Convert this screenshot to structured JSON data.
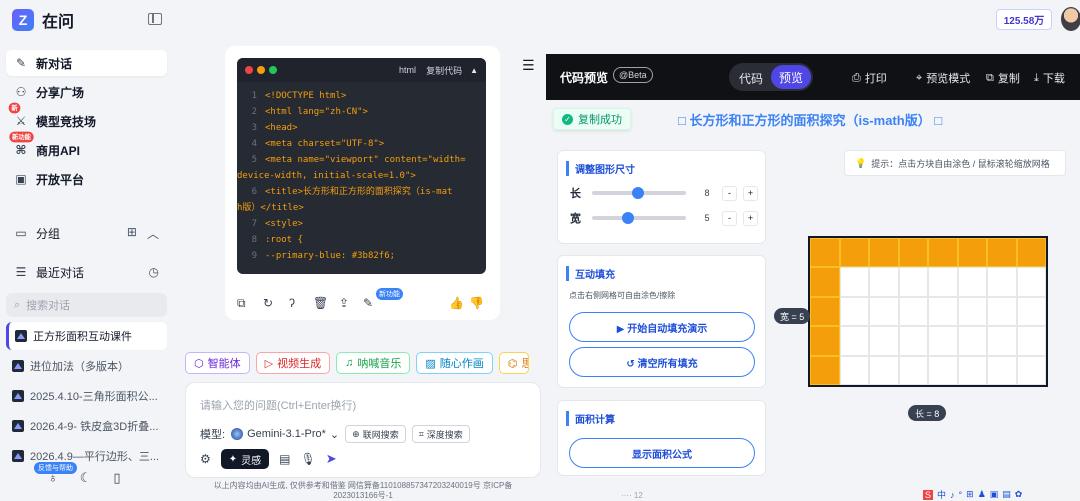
{
  "app": {
    "brand_logo": "Z",
    "name": "在问"
  },
  "sidebar": {
    "nav": [
      {
        "label": "新对话",
        "icon": "chat-plus-icon"
      },
      {
        "label": "分享广场",
        "icon": "grid-icon"
      },
      {
        "label": "模型竞技场",
        "icon": "arena-icon",
        "badge": "新"
      },
      {
        "label": "商用API",
        "icon": "api-icon",
        "badge": "新功能"
      },
      {
        "label": "开放平台",
        "icon": "platform-icon"
      }
    ],
    "group_label": "分组",
    "recent_label": "最近对话",
    "search_placeholder": "搜索对话",
    "conversations": [
      "正方形面积互动课件",
      "进位加法（多版本）",
      "2025.4.10-三角形面积公...",
      "2026.4-9- 铁皮盒3D折叠...",
      "2026.4.9—平行边形、三..."
    ],
    "feedback_tag": "反馈与帮助"
  },
  "code_block": {
    "lang": "html",
    "copy_label": "复制代码",
    "lines": [
      {
        "n": "1",
        "t": "<!DOCTYPE html>"
      },
      {
        "n": "2",
        "t": "<html lang=\"zh-CN\">"
      },
      {
        "n": "3",
        "t": "<head>"
      },
      {
        "n": "4",
        "t": "    <meta charset=\"UTF-8\">"
      },
      {
        "n": "5",
        "t": "    <meta name=\"viewport\" content=\"width="
      },
      {
        "n": "",
        "t": "device-width, initial-scale=1.0\">"
      },
      {
        "n": "6",
        "t": "    <title>长方形和正方形的面积探究（is-mat"
      },
      {
        "n": "",
        "t": "h版）</title>"
      },
      {
        "n": "7",
        "t": "    <style>"
      },
      {
        "n": "8",
        "t": "        :root {"
      },
      {
        "n": "9",
        "t": "            --primary-blue: #3b82f6;"
      }
    ],
    "new_feature_badge": "新功能"
  },
  "chips": [
    {
      "label": "智能体",
      "color": "#8b5cf6"
    },
    {
      "label": "视频生成",
      "color": "#ef4444"
    },
    {
      "label": "呐喊音乐",
      "color": "#22c55e"
    },
    {
      "label": "随心作画",
      "color": "#0ea5e9"
    },
    {
      "label": "思",
      "color": "#f59e0b"
    }
  ],
  "input": {
    "placeholder": "请输入您的问题(Ctrl+Enter换行)",
    "model_label": "模型:",
    "model_name": "Gemini-3.1-Pro*",
    "web_search": "联网搜索",
    "deep_search": "深度搜索",
    "spark_label": "灵感"
  },
  "disclaimer": "以上内容均由AI生成, 仅供参考和借鉴 网信算备110108857347203240019号 京ICP备2023013166号-1",
  "top_right": {
    "balance": "125.58万"
  },
  "preview": {
    "title": "代码预览",
    "beta": "@Beta",
    "tab_code": "代码",
    "tab_preview": "预览",
    "actions": [
      "打印",
      "预览模式",
      "复制",
      "下载"
    ],
    "copied_toast": "复制成功",
    "doc_title": "□ 长方形和正方形的面积探究（is-math版） □",
    "resize_card": {
      "title": "调整图形尺寸",
      "length_label": "长",
      "length_value": "8",
      "width_label": "宽",
      "width_value": "5",
      "minus": "-",
      "plus": "+"
    },
    "fill_card": {
      "title": "互动填充",
      "desc": "点击右侧网格可自由涂色/擦除",
      "auto_fill": "▶ 开始自动填充演示",
      "clear": "↺ 清空所有填充"
    },
    "area_card": {
      "title": "面积计算",
      "show_formula": "显示面积公式"
    },
    "bottom_peek": "····  12",
    "hint": "提示：点击方块自由涂色 / 鼠标滚轮缩放网格",
    "width_tag": "宽 = 5",
    "length_tag": "长 = 8",
    "grid": {
      "cols": 8,
      "rows": 5,
      "filled_cells": [
        [
          0,
          0
        ],
        [
          1,
          0
        ],
        [
          2,
          0
        ],
        [
          3,
          0
        ],
        [
          4,
          0
        ],
        [
          5,
          0
        ],
        [
          6,
          0
        ],
        [
          7,
          0
        ],
        [
          0,
          1
        ],
        [
          0,
          2
        ],
        [
          0,
          3
        ],
        [
          0,
          4
        ]
      ]
    }
  },
  "taskbar": [
    "S",
    "中",
    "♪",
    "°",
    "⊞",
    "♟",
    "▣",
    "▤",
    "✿"
  ]
}
